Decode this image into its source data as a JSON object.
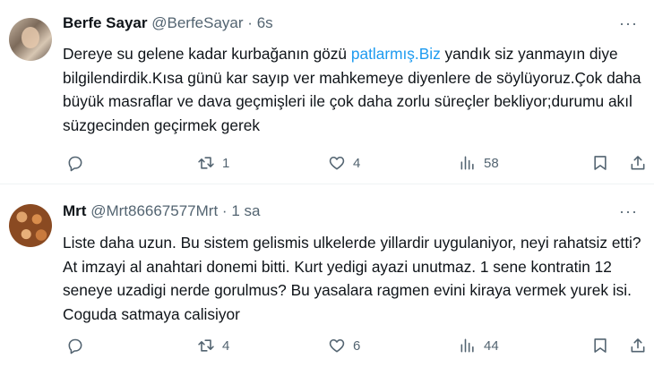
{
  "tweets": [
    {
      "name": "Berfe Sayar",
      "handle": "@BerfeSayar",
      "separator": "·",
      "time": "6s",
      "more": "···",
      "text_before": "Dereye su gelene kadar kurbağanın gözü ",
      "link": "patlarmış.Biz",
      "text_after": " yandık siz yanmayın diye bilgilendirdik.Kısa günü kar sayıp ver mahkemeye diyenlere de söylüyoruz.Çok daha büyük masraflar ve dava geçmişleri ile çok daha zorlu süreçler bekliyor;durumu akıl süzgecinden geçirmek gerek",
      "replies": "",
      "retweets": "1",
      "likes": "4",
      "views": "58"
    },
    {
      "name": "Mrt",
      "handle": "@Mrt86667577Mrt",
      "separator": "·",
      "time": "1 sa",
      "more": "···",
      "text_before": "Liste daha uzun. Bu sistem gelismis ulkelerde yillardir uygulaniyor, neyi rahatsiz etti? At imzayi al anahtari donemi bitti. Kurt yedigi ayazi unutmaz. 1 sene kontratin 12 seneye uzadigi nerde gorulmus? Bu yasalara ragmen evini kiraya vermek yurek isi. Coguda satmaya calisiyor",
      "link": "",
      "text_after": "",
      "replies": "",
      "retweets": "4",
      "likes": "6",
      "views": "44"
    }
  ],
  "icons": [
    "reply-icon",
    "retweet-icon",
    "like-icon",
    "views-icon",
    "bookmark-icon",
    "share-icon"
  ],
  "colors": {
    "link": "#1d9bf0",
    "secondary": "#536471",
    "text": "#0f1419",
    "divider": "#eff3f4"
  }
}
